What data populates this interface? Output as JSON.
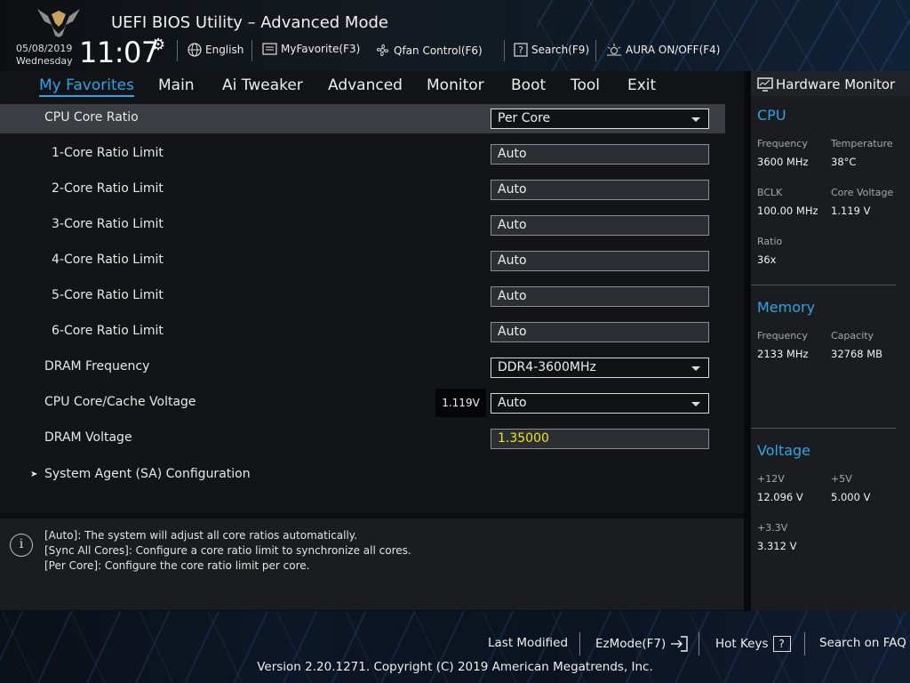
{
  "header": {
    "title": "UEFI BIOS Utility – Advanced Mode",
    "date": "05/08/2019",
    "weekday": "Wednesday",
    "time": "11:07",
    "items": [
      {
        "label": "English",
        "icon": "globe-icon"
      },
      {
        "label": "MyFavorite(F3)",
        "icon": "favorite-icon"
      },
      {
        "label": "Qfan Control(F6)",
        "icon": "fan-icon"
      },
      {
        "label": "Search(F9)",
        "icon": "search-icon"
      },
      {
        "label": "AURA ON/OFF(F4)",
        "icon": "aura-icon"
      }
    ]
  },
  "tabs": [
    {
      "label": "My Favorites",
      "active": true
    },
    {
      "label": "Main"
    },
    {
      "label": "Ai Tweaker"
    },
    {
      "label": "Advanced"
    },
    {
      "label": "Monitor"
    },
    {
      "label": "Boot"
    },
    {
      "label": "Tool"
    },
    {
      "label": "Exit"
    }
  ],
  "settings": [
    {
      "label": "CPU Core Ratio",
      "value": "Per Core",
      "type": "dropdown",
      "selected": true
    },
    {
      "label": "1-Core Ratio Limit",
      "value": "Auto",
      "type": "text"
    },
    {
      "label": "2-Core Ratio Limit",
      "value": "Auto",
      "type": "text"
    },
    {
      "label": "3-Core Ratio Limit",
      "value": "Auto",
      "type": "text"
    },
    {
      "label": "4-Core Ratio Limit",
      "value": "Auto",
      "type": "text"
    },
    {
      "label": "5-Core Ratio Limit",
      "value": "Auto",
      "type": "text"
    },
    {
      "label": "6-Core Ratio Limit",
      "value": "Auto",
      "type": "text"
    },
    {
      "label": "DRAM Frequency",
      "value": "DDR4-3600MHz",
      "type": "dropdown"
    },
    {
      "label": "CPU Core/Cache Voltage",
      "value": "Auto",
      "type": "dropdown",
      "current": "1.119V"
    },
    {
      "label": "DRAM Voltage",
      "value": "1.35000",
      "type": "text",
      "highlight": "#f5e31a"
    }
  ],
  "submenu": "System Agent (SA) Configuration",
  "help": [
    "[Auto]: The system will adjust all core ratios automatically.",
    "[Sync All Cores]: Configure a core ratio limit to synchronize all cores.",
    "[Per Core]: Configure the core ratio limit per core."
  ],
  "monitor": {
    "title": "Hardware Monitor",
    "cpu": {
      "title": "CPU",
      "frequency_label": "Frequency",
      "frequency": "3600 MHz",
      "temperature_label": "Temperature",
      "temperature": "38°C",
      "bclk_label": "BCLK",
      "bclk": "100.00 MHz",
      "voltage_label": "Core Voltage",
      "voltage": "1.119 V",
      "ratio_label": "Ratio",
      "ratio": "36x"
    },
    "memory": {
      "title": "Memory",
      "frequency_label": "Frequency",
      "frequency": "2133 MHz",
      "capacity_label": "Capacity",
      "capacity": "32768 MB"
    },
    "voltage": {
      "title": "Voltage",
      "v12_label": "+12V",
      "v12": "12.096 V",
      "v5_label": "+5V",
      "v5": "5.000 V",
      "v33_label": "+3.3V",
      "v33": "3.312 V"
    }
  },
  "footer": {
    "last_modified": "Last Modified",
    "ezmode": "EzMode(F7)",
    "hotkeys": "Hot Keys",
    "hotkeys_key": "?",
    "faq": "Search on FAQ",
    "copyright": "Version 2.20.1271. Copyright (C) 2019 American Megatrends, Inc."
  },
  "colors": {
    "accent": "#27a6e9",
    "highlight": "#f5e31a",
    "background": "#121417"
  }
}
